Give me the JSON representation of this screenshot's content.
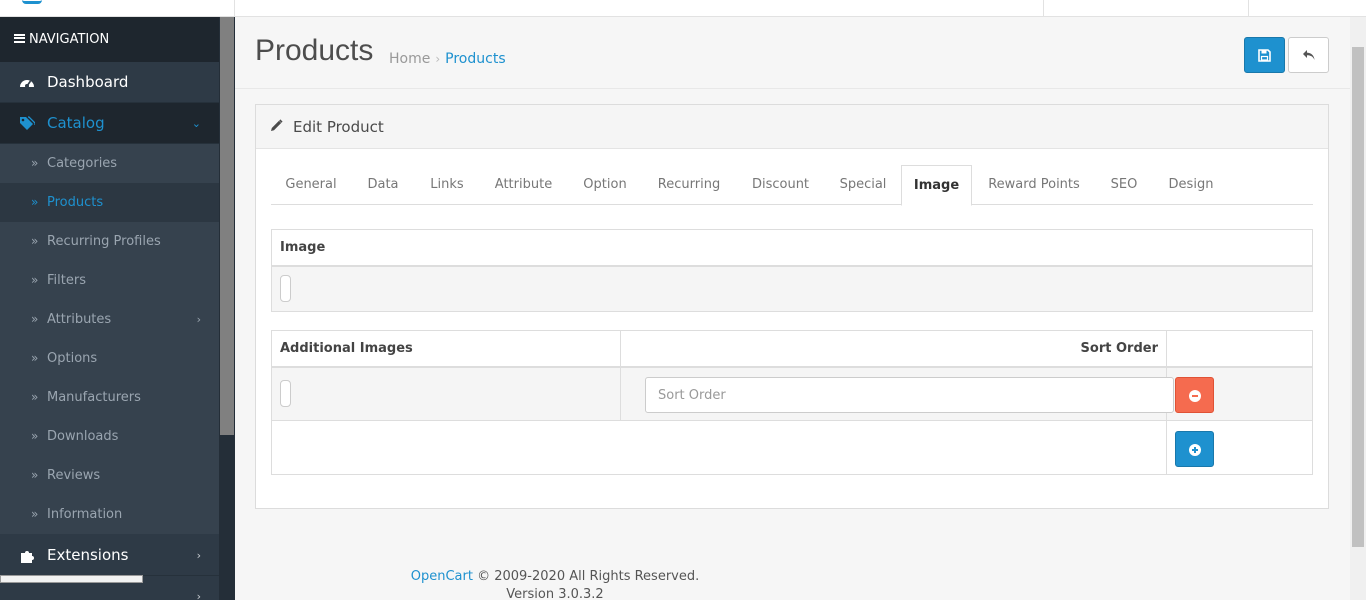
{
  "sidebar": {
    "navigation_label": "NAVIGATION",
    "main": [
      {
        "label": "Dashboard",
        "icon": "dashboard-icon"
      },
      {
        "label": "Catalog",
        "icon": "tags-icon"
      },
      {
        "label": "Extensions",
        "icon": "puzzle-icon"
      }
    ],
    "catalog_items": [
      {
        "label": "Categories"
      },
      {
        "label": "Products"
      },
      {
        "label": "Recurring Profiles"
      },
      {
        "label": "Filters"
      },
      {
        "label": "Attributes"
      },
      {
        "label": "Options"
      },
      {
        "label": "Manufacturers"
      },
      {
        "label": "Downloads"
      },
      {
        "label": "Reviews"
      },
      {
        "label": "Information"
      }
    ]
  },
  "page": {
    "title": "Products",
    "breadcrumb": [
      "Home",
      "Products"
    ]
  },
  "panel": {
    "title": "Edit Product",
    "tabs": [
      "General",
      "Data",
      "Links",
      "Attribute",
      "Option",
      "Recurring",
      "Discount",
      "Special",
      "Image",
      "Reward Points",
      "SEO",
      "Design"
    ],
    "active_tab": "Image"
  },
  "image_table": {
    "header": "Image"
  },
  "additional_table": {
    "headers": [
      "Additional Images",
      "Sort Order"
    ],
    "sort_order_placeholder": "Sort Order"
  },
  "footer": {
    "brand": "OpenCart",
    "copyright": "© 2009-2020 All Rights Reserved.",
    "version": "Version 3.0.3.2"
  },
  "colors": {
    "primary": "#1e91cf",
    "danger": "#f56b4f",
    "sidebar": "#2e3a46"
  }
}
